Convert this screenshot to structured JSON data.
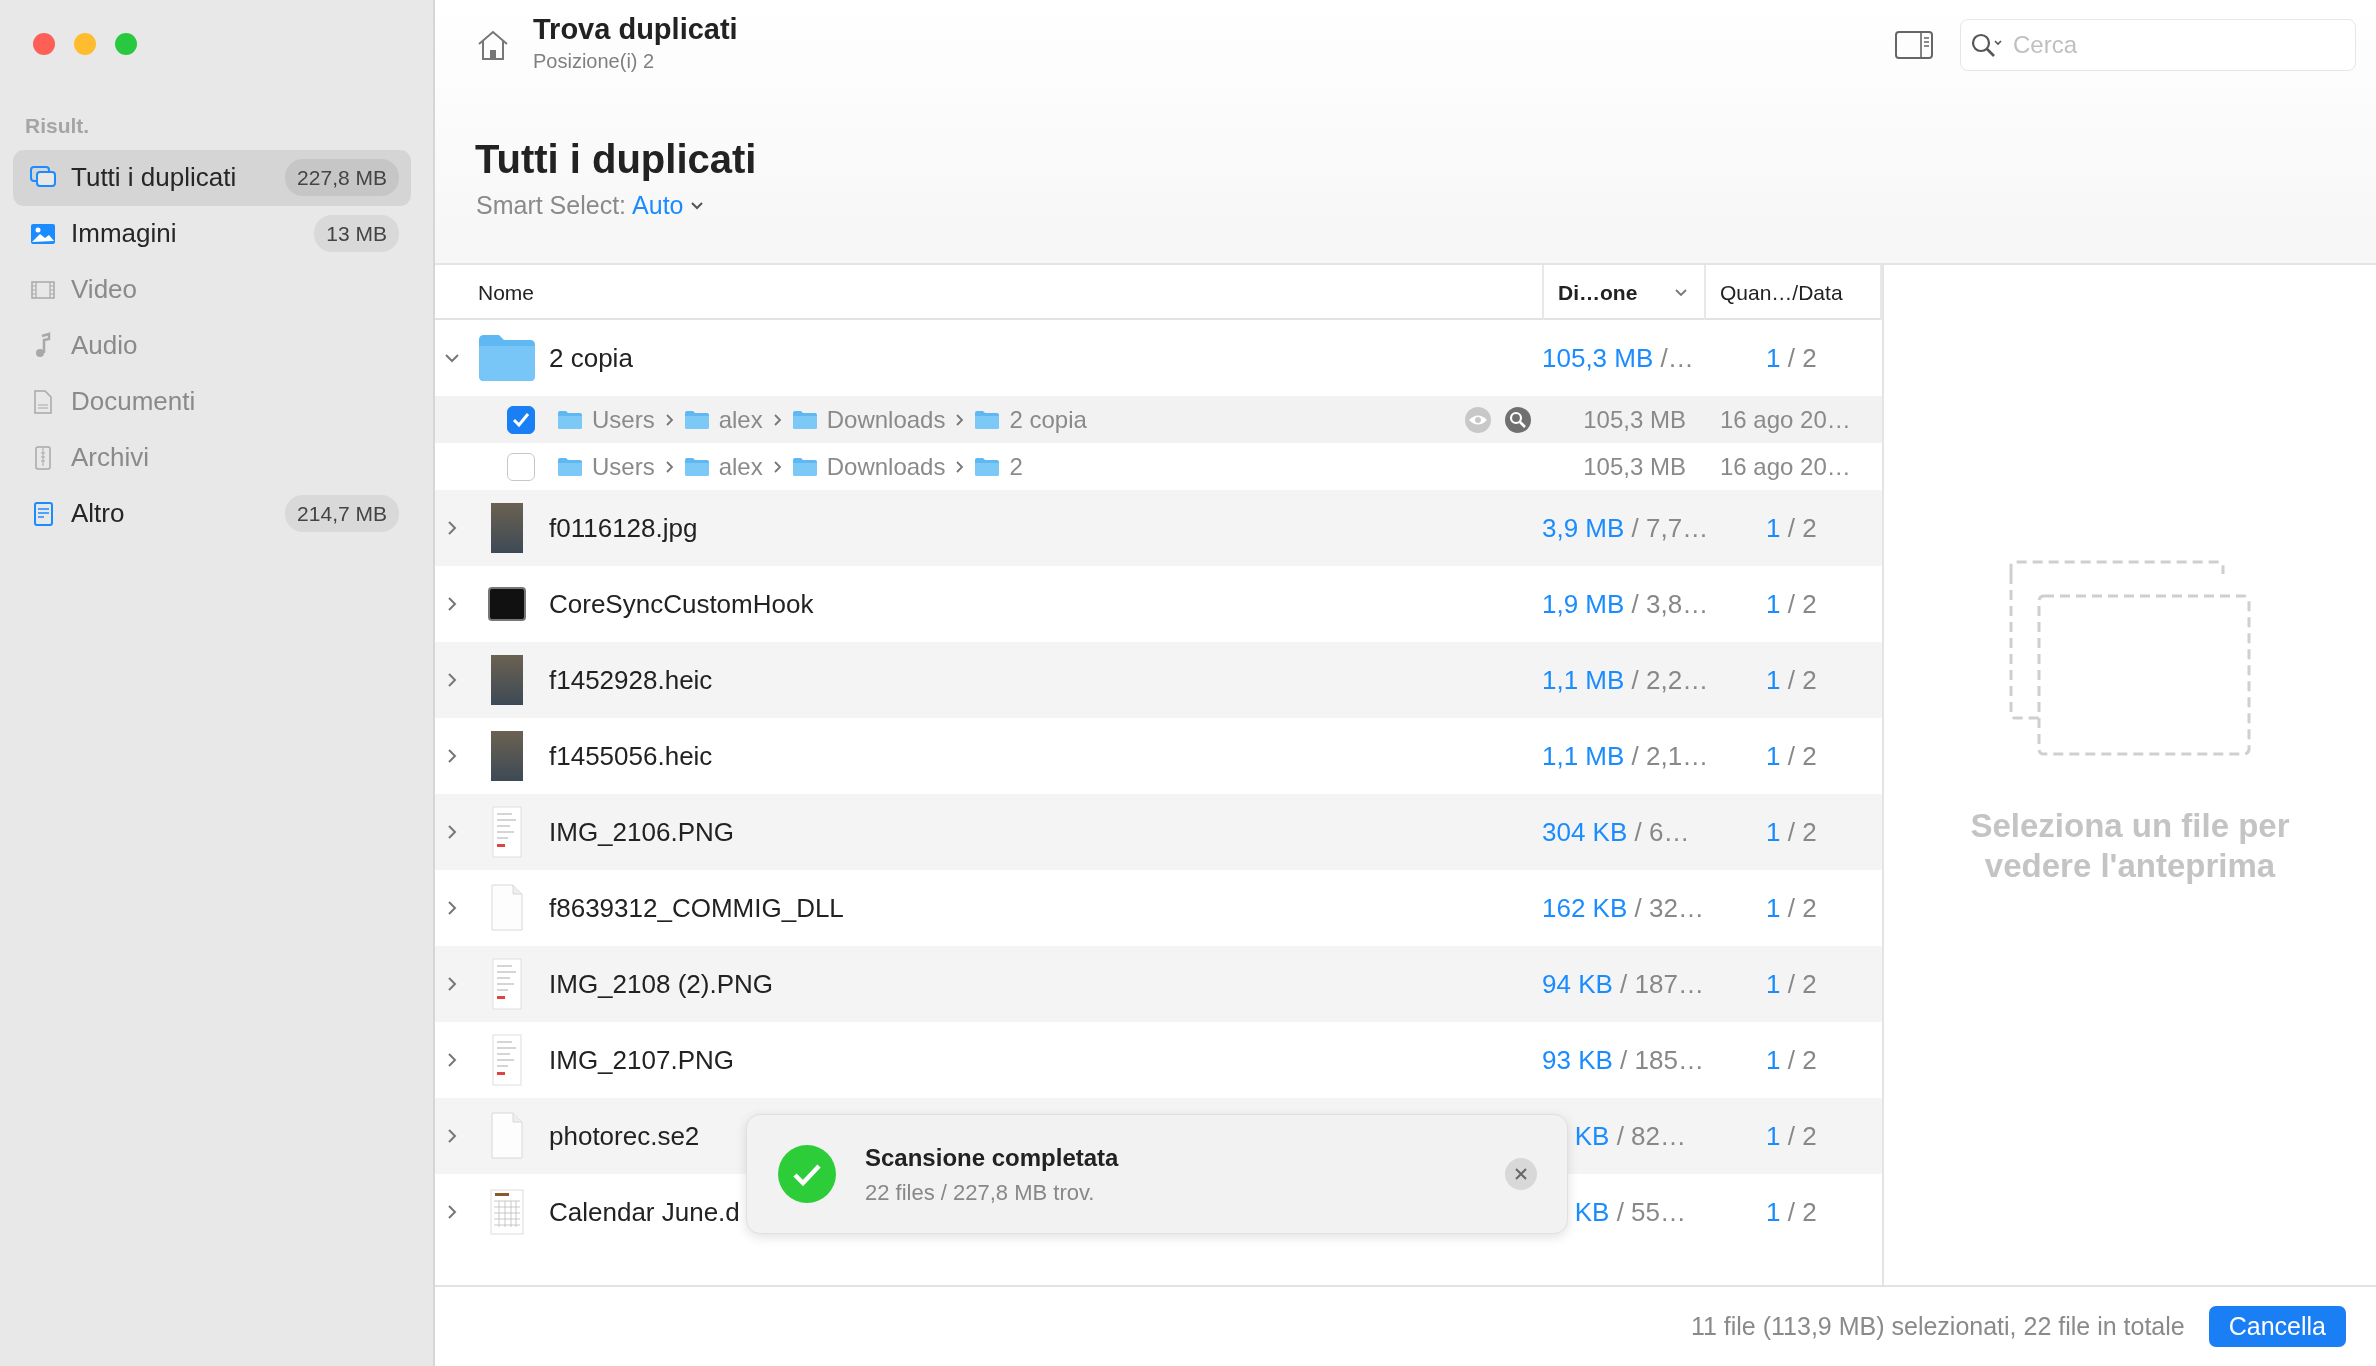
{
  "toolbar": {
    "title": "Trova duplicati",
    "subtitle": "Posizione(i) 2",
    "search": {
      "placeholder": "Cerca"
    }
  },
  "sidebar": {
    "section": "Risult.",
    "items": [
      {
        "label": "Tutti i duplicati",
        "kind": "duplicates",
        "badge": "227,8 MB",
        "selected": true,
        "disabled": false
      },
      {
        "label": "Immagini",
        "kind": "image",
        "badge": "13 MB",
        "selected": false,
        "disabled": false
      },
      {
        "label": "Video",
        "kind": "film",
        "selected": false,
        "disabled": true
      },
      {
        "label": "Audio",
        "kind": "music",
        "selected": false,
        "disabled": true
      },
      {
        "label": "Documenti",
        "kind": "document",
        "selected": false,
        "disabled": true
      },
      {
        "label": "Archivi",
        "kind": "archive",
        "selected": false,
        "disabled": true
      },
      {
        "label": "Altro",
        "kind": "text",
        "badge": "214,7 MB",
        "selected": false,
        "disabled": false
      }
    ]
  },
  "heading": {
    "title": "Tutti i duplicati",
    "smart_select_label": "Smart Select:",
    "smart_select_value": "Auto"
  },
  "table": {
    "columns": [
      {
        "label": "Nome",
        "sorted": false
      },
      {
        "label": "Di…one",
        "sorted": true
      },
      {
        "label": "Quan…/Data",
        "sorted": false
      }
    ],
    "rows": [
      {
        "name": "2 copia",
        "kind": "folder",
        "expanded": true,
        "size": "105,3 MB",
        "size_rest": "/…",
        "count": "1",
        "count_rest": "/ 2",
        "children": [
          {
            "checked": true,
            "highlighted": true,
            "path": [
              "Users",
              "alex",
              "Downloads",
              "2 copia"
            ],
            "size": "105,3 MB",
            "date": "16 ago 20…"
          },
          {
            "checked": false,
            "highlighted": false,
            "path": [
              "Users",
              "alex",
              "Downloads",
              "2"
            ],
            "size": "105,3 MB",
            "date": "16 ago 20…"
          }
        ]
      },
      {
        "name": "f0116128.jpg",
        "kind": "photo",
        "expanded": false,
        "size": "3,9 MB",
        "size_rest": "/ 7,7…",
        "count": "1",
        "count_rest": "/ 2"
      },
      {
        "name": "CoreSyncCustomHook",
        "kind": "terminal",
        "expanded": false,
        "size": "1,9 MB",
        "size_rest": "/ 3,8…",
        "count": "1",
        "count_rest": "/ 2"
      },
      {
        "name": "f1452928.heic",
        "kind": "photo",
        "expanded": false,
        "size": "1,1 MB",
        "size_rest": "/ 2,2…",
        "count": "1",
        "count_rest": "/ 2"
      },
      {
        "name": "f1455056.heic",
        "kind": "photo",
        "expanded": false,
        "size": "1,1 MB",
        "size_rest": "/ 2,1…",
        "count": "1",
        "count_rest": "/ 2"
      },
      {
        "name": "IMG_2106.PNG",
        "kind": "screenshot",
        "expanded": false,
        "size": "304 KB",
        "size_rest": "/ 6…",
        "count": "1",
        "count_rest": "/ 2"
      },
      {
        "name": "f8639312_COMMIG_DLL",
        "kind": "document",
        "expanded": false,
        "size": "162 KB",
        "size_rest": "/ 32…",
        "count": "1",
        "count_rest": "/ 2"
      },
      {
        "name": "IMG_2108 (2).PNG",
        "kind": "screenshot",
        "expanded": false,
        "size": "94 KB",
        "size_rest": "/ 187…",
        "count": "1",
        "count_rest": "/ 2"
      },
      {
        "name": "IMG_2107.PNG",
        "kind": "screenshot",
        "expanded": false,
        "size": "93 KB",
        "size_rest": "/ 185…",
        "count": "1",
        "count_rest": "/ 2"
      },
      {
        "name": "photorec.se2",
        "kind": "document",
        "expanded": false,
        "size": "KB",
        "size_rest": "/ 82…",
        "count": "1",
        "count_rest": "/ 2"
      },
      {
        "name": "Calendar June.d",
        "kind": "calendar",
        "expanded": false,
        "size": "KB",
        "size_rest": "/ 55…",
        "count": "1",
        "count_rest": "/ 2"
      }
    ]
  },
  "toast": {
    "title": "Scansione completata",
    "message": "22 files / 227,8 MB trov."
  },
  "preview": {
    "message": "Seleziona un file per vedere l'anteprima"
  },
  "status_bar": {
    "summary": "11 file (113,9 MB) selezionati, 22 file in totale",
    "button": "Cancella"
  }
}
